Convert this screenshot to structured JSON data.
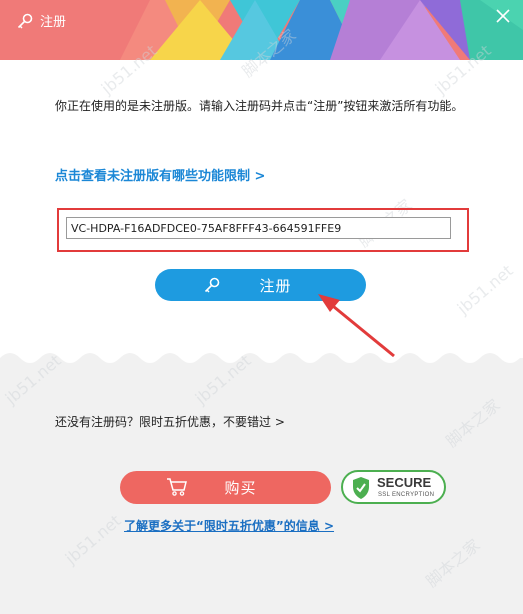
{
  "window": {
    "title": "注册",
    "close_icon": "close-icon"
  },
  "colors": {
    "accent_blue": "#1e9be0",
    "buy_red": "#ee6761",
    "highlight_red": "#e23b3b",
    "secure_green": "#4caf50"
  },
  "main": {
    "description": "你正在使用的是未注册版。请输入注册码并点击“注册”按钮来激活所有功能。",
    "limit_link": "点击查看未注册版有哪些功能限制 >",
    "key_value": "VC-HDPA-F16ADFDCE0-75AF8FFF43-664591FFE9",
    "register_label": "注册"
  },
  "promo": {
    "no_code_text": "还没有注册码？限时五折优惠，不要错过 >",
    "buy_label": "购买",
    "secure_title": "SECURE",
    "secure_sub": "SSL ENCRYPTION",
    "more_link": "了解更多关于“限时五折优惠”的信息 >"
  },
  "watermarks": [
    "jb51.net",
    "脚本之家"
  ]
}
